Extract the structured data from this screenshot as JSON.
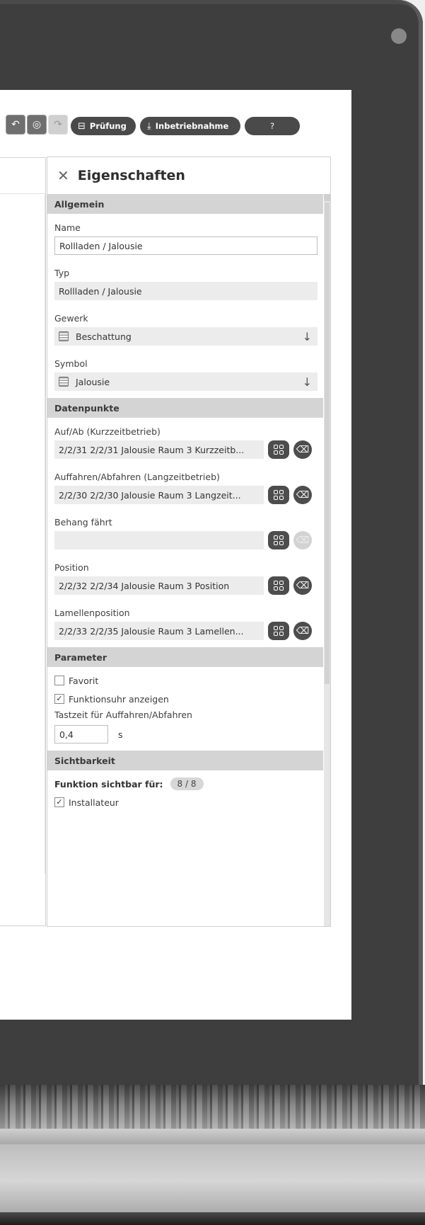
{
  "toolbar": {
    "pruefung_label": "Prüfung",
    "inbetriebnahme_label": "Inbetriebnahme",
    "help_label": "?"
  },
  "panel": {
    "title": "Eigenschaften",
    "sections": {
      "allgemein": "Allgemein",
      "datenpunkte": "Datenpunkte",
      "parameter": "Parameter",
      "sichtbarkeit": "Sichtbarkeit"
    },
    "allgemein": {
      "name_label": "Name",
      "name_value": "Rollladen / Jalousie",
      "typ_label": "Typ",
      "typ_value": "Rollladen / Jalousie",
      "gewerk_label": "Gewerk",
      "gewerk_value": "Beschattung",
      "symbol_label": "Symbol",
      "symbol_value": "Jalousie"
    },
    "datenpunkte": [
      {
        "label": "Auf/Ab (Kurzzeitbetrieb)",
        "value": "2/2/31  2/2/31  Jalousie Raum 3 Kurzzeitb...",
        "clear_enabled": true
      },
      {
        "label": "Auffahren/Abfahren (Langzeitbetrieb)",
        "value": "2/2/30  2/2/30  Jalousie Raum 3 Langzeit...",
        "clear_enabled": true
      },
      {
        "label": "Behang fährt",
        "value": "",
        "clear_enabled": false
      },
      {
        "label": "Position",
        "value": "2/2/32  2/2/34  Jalousie Raum 3 Position",
        "clear_enabled": true
      },
      {
        "label": "Lamellenposition",
        "value": "2/2/33  2/2/35  Jalousie Raum 3 Lamellen...",
        "clear_enabled": true
      }
    ],
    "parameter": {
      "favorit_label": "Favorit",
      "favorit_checked": false,
      "funktionsuhr_label": "Funktionsuhr anzeigen",
      "funktionsuhr_checked": true,
      "tastzeit_label": "Tastzeit für Auffahren/Abfahren",
      "tastzeit_value": "0,4",
      "tastzeit_unit": "s"
    },
    "sichtbarkeit": {
      "label": "Funktion sichtbar für:",
      "count": "8 / 8",
      "installateur_label": "Installateur",
      "installateur_checked": true
    }
  }
}
